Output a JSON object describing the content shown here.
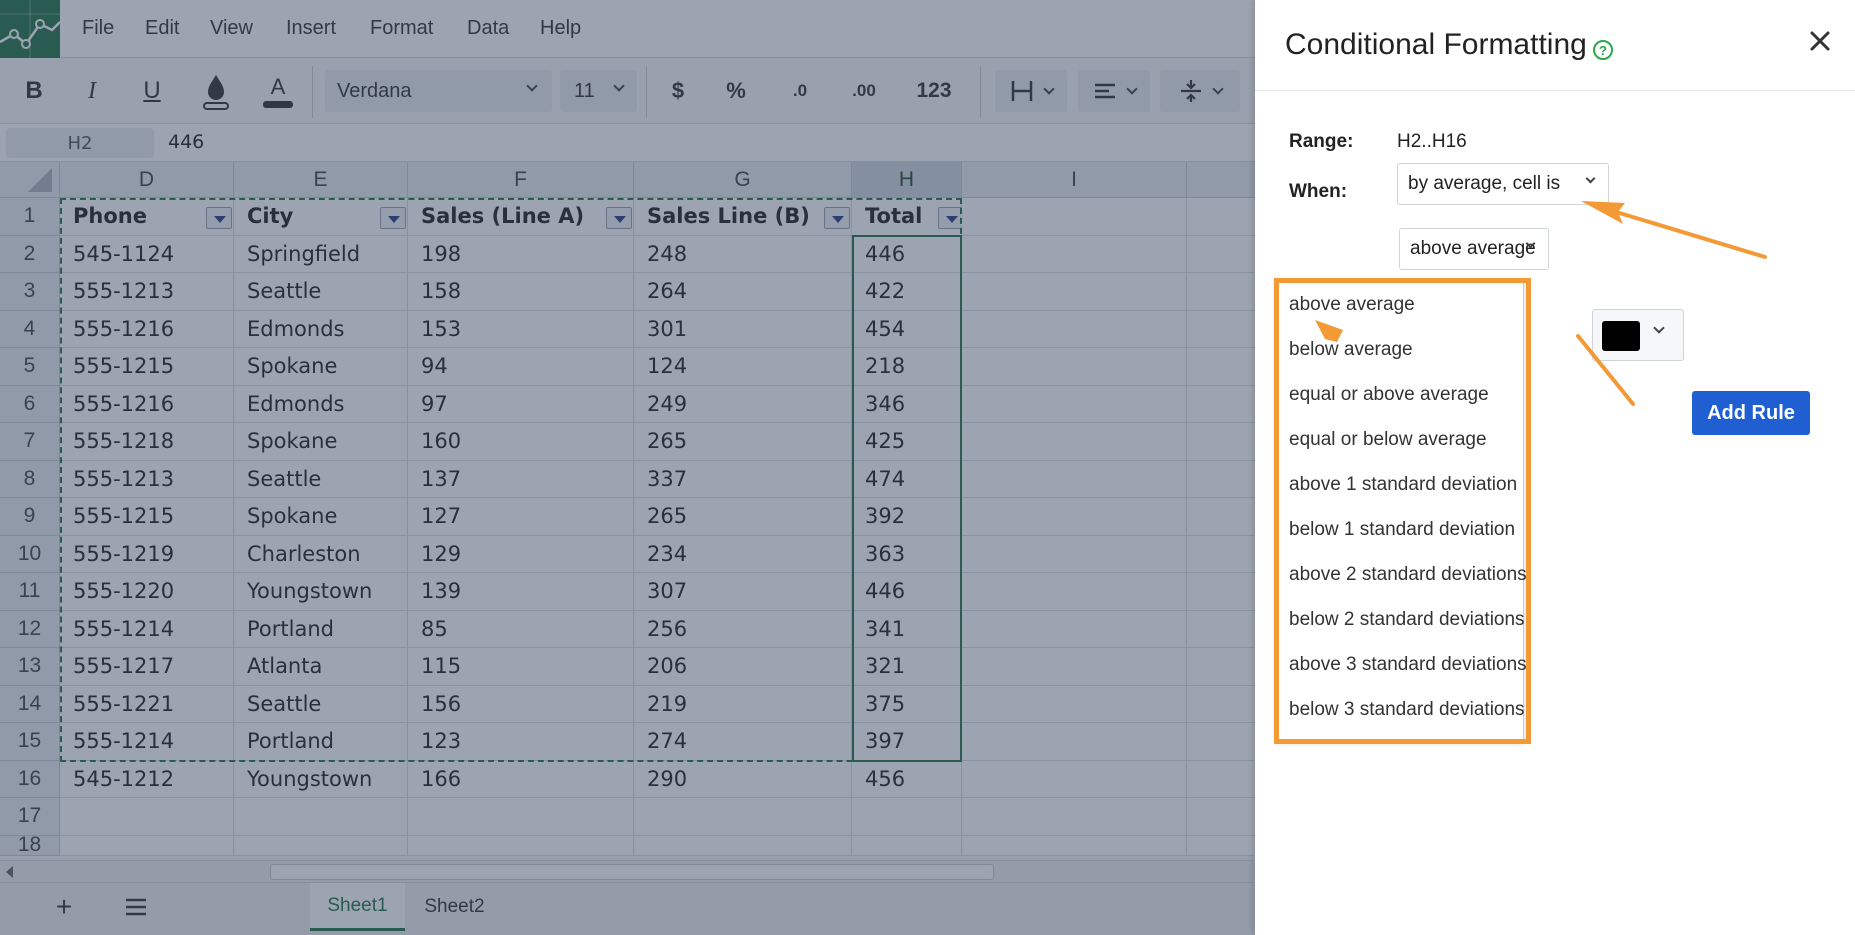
{
  "menu": [
    "File",
    "Edit",
    "View",
    "Insert",
    "Format",
    "Data",
    "Help"
  ],
  "toolbar": {
    "bold": "B",
    "italic": "I",
    "underline": "U",
    "font_color_letter": "A",
    "font_name": "Verdana",
    "font_size": "11",
    "currency": "$",
    "percent": "%",
    "decimal_decrease": ".0",
    "decimal_increase": ".00",
    "number_format": "123"
  },
  "formula_bar": {
    "cell_ref": "H2",
    "value": "446"
  },
  "grid": {
    "columns": [
      "D",
      "E",
      "F",
      "G",
      "H",
      "I"
    ],
    "row_numbers": [
      "1",
      "2",
      "3",
      "4",
      "5",
      "6",
      "7",
      "8",
      "9",
      "10",
      "11",
      "12",
      "13",
      "14",
      "15",
      "16",
      "17",
      "18"
    ],
    "headers": [
      "Phone",
      "City",
      "Sales (Line A)",
      "Sales Line (B)",
      "Total"
    ],
    "rows": [
      [
        "545-1124",
        "Springfield",
        "198",
        "248",
        "446"
      ],
      [
        "555-1213",
        "Seattle",
        "158",
        "264",
        "422"
      ],
      [
        "555-1216",
        "Edmonds",
        "153",
        "301",
        "454"
      ],
      [
        "555-1215",
        "Spokane",
        "94",
        "124",
        "218"
      ],
      [
        "555-1216",
        "Edmonds",
        "97",
        "249",
        "346"
      ],
      [
        "555-1218",
        "Spokane",
        "160",
        "265",
        "425"
      ],
      [
        "555-1213",
        "Seattle",
        "137",
        "337",
        "474"
      ],
      [
        "555-1215",
        "Spokane",
        "127",
        "265",
        "392"
      ],
      [
        "555-1219",
        "Charleston",
        "129",
        "234",
        "363"
      ],
      [
        "555-1220",
        "Youngstown",
        "139",
        "307",
        "446"
      ],
      [
        "555-1214",
        "Portland",
        "85",
        "256",
        "341"
      ],
      [
        "555-1217",
        "Atlanta",
        "115",
        "206",
        "321"
      ],
      [
        "555-1221",
        "Seattle",
        "156",
        "219",
        "375"
      ],
      [
        "555-1214",
        "Portland",
        "123",
        "274",
        "397"
      ],
      [
        "545-1212",
        "Youngstown",
        "166",
        "290",
        "456"
      ]
    ]
  },
  "sheets": [
    "Sheet1",
    "Sheet2"
  ],
  "panel": {
    "title": "Conditional Formatting",
    "help": "?",
    "range_label": "Range:",
    "range_value": "H2..H16",
    "when_label": "When:",
    "when_value": "by average, cell is",
    "condition_value": "above average",
    "options": [
      "above average",
      "below average",
      "equal or above average",
      "equal or below average",
      "above 1 standard deviation",
      "below 1 standard deviation",
      "above 2 standard deviations",
      "below 2 standard deviations",
      "above 3 standard deviations",
      "below 3 standard deviations"
    ],
    "add_rule": "Add Rule",
    "swatch_color": "#000000"
  },
  "colors": {
    "accent_green": "#217346",
    "annotation_orange": "#f39a36",
    "button_blue": "#1f5fd1"
  }
}
